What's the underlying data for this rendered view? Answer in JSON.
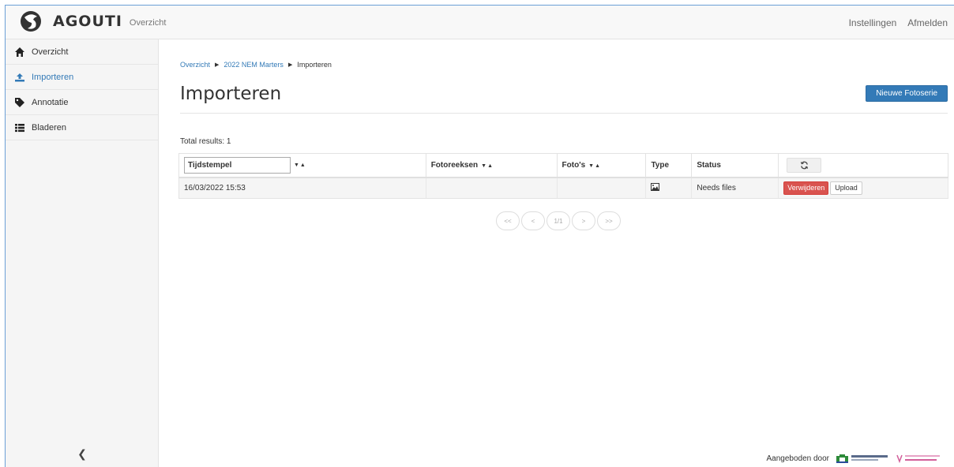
{
  "topbar": {
    "brand": "AGOUTI",
    "subtitle": "Overzicht",
    "nav": [
      "Instellingen",
      "Afmelden"
    ]
  },
  "sidebar": {
    "items": [
      {
        "label": "Overzicht",
        "icon": "home-icon",
        "active": false
      },
      {
        "label": "Importeren",
        "icon": "upload-icon",
        "active": true
      },
      {
        "label": "Annotatie",
        "icon": "tag-icon",
        "active": false
      },
      {
        "label": "Bladeren",
        "icon": "list-icon",
        "active": false
      }
    ],
    "collapse_icon": "chevron-left-icon"
  },
  "breadcrumb": [
    "Overzicht",
    "2022 NEM Marters",
    "Importeren"
  ],
  "page": {
    "title": "Importeren",
    "new_button": "Nieuwe Fotoserie",
    "total_results": "Total results: 1"
  },
  "table": {
    "filter_value": "Tijdstempel",
    "columns": [
      "Fotoreeksen",
      "Foto's",
      "Type",
      "Status"
    ],
    "rows": [
      {
        "timestamp": "16/03/2022 15:53",
        "fotoreeksen": "",
        "fotos": "",
        "type_icon": "image-icon",
        "status": "Needs files",
        "actions": [
          "Verwijderen",
          "Upload"
        ]
      }
    ]
  },
  "pagination": [
    "<<",
    "<",
    "1/1",
    ">",
    ">>"
  ],
  "footer": {
    "label": "Aangeboden door",
    "logos": [
      "WAGENINGEN",
      "RESEARCH INSTITUTE NATURE AND FOREST"
    ]
  },
  "colors": {
    "primary": "#337ab7",
    "danger": "#d9534f",
    "wageningen_green": "#2e8b3a",
    "inbo_pink": "#d25f9a"
  }
}
